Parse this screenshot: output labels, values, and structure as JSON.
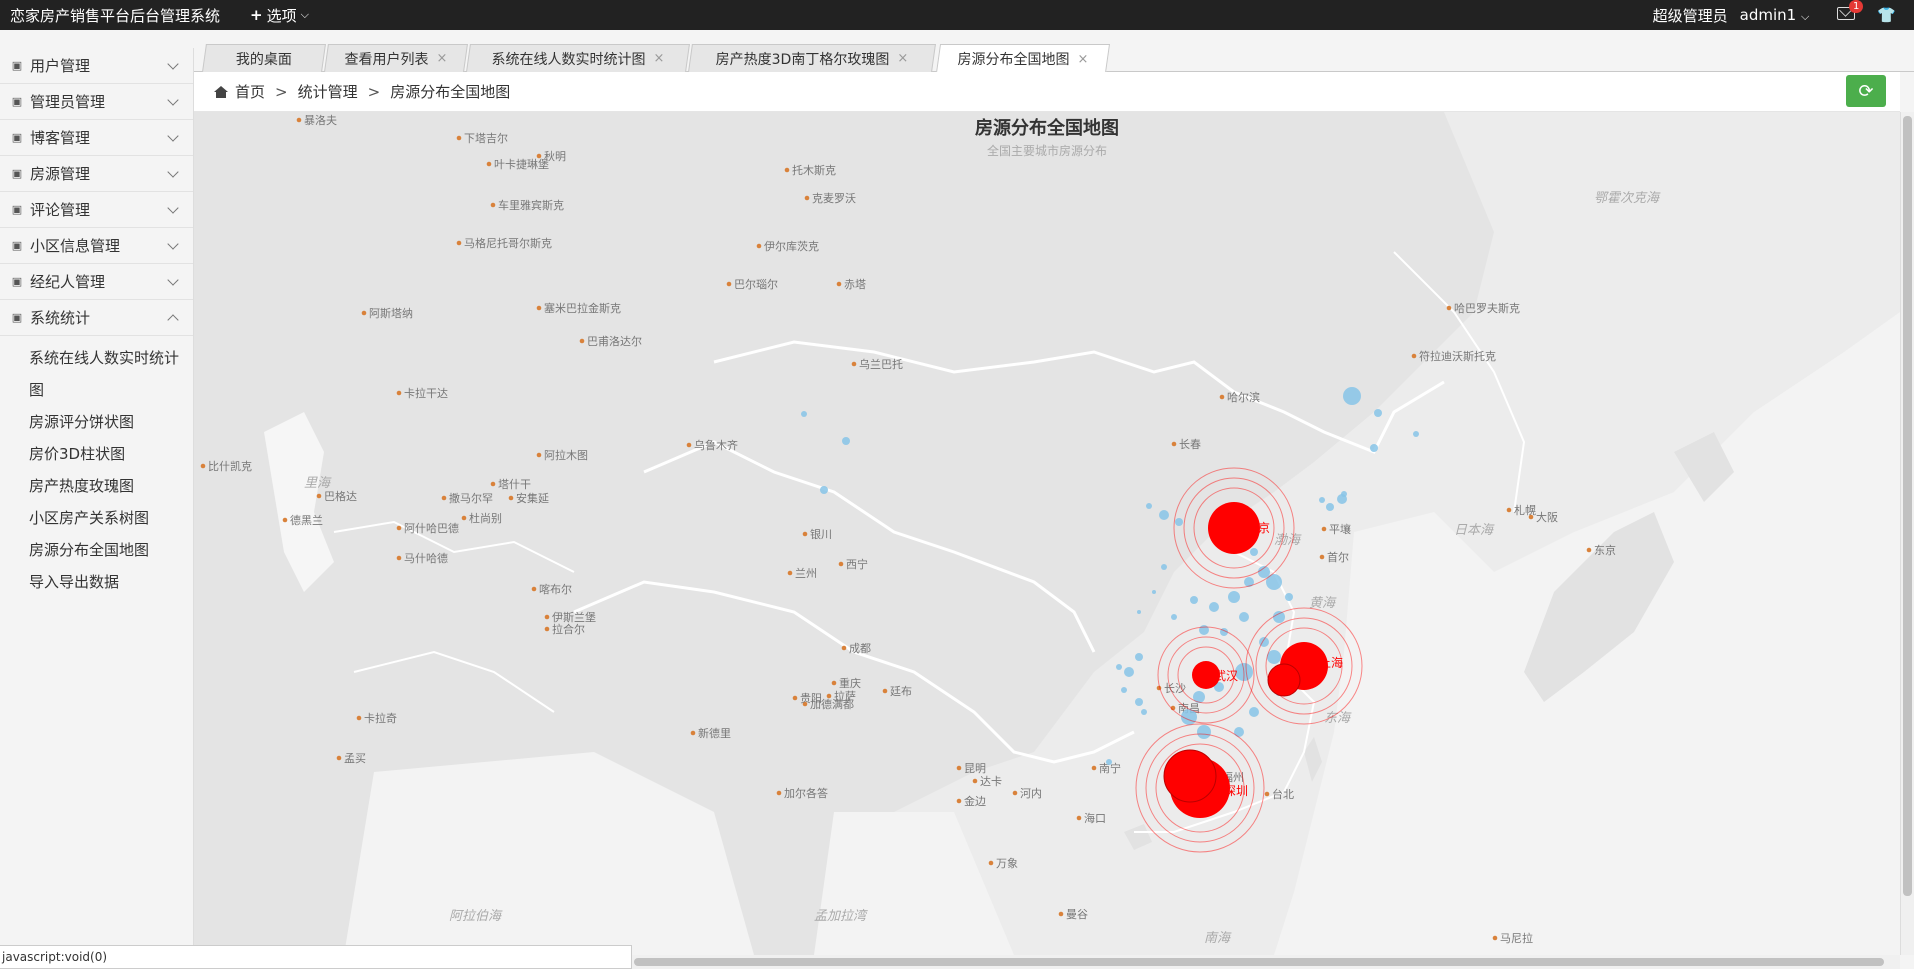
{
  "topbar": {
    "title": "恋家房产销售平台后台管理系统",
    "options_label": "选项",
    "role": "超级管理员",
    "user": "admin1",
    "badge_count": "1"
  },
  "sidebar": {
    "items": [
      {
        "label": "用户管理",
        "icon": "user-group-icon"
      },
      {
        "label": "管理员管理",
        "icon": "admin-icon"
      },
      {
        "label": "博客管理",
        "icon": "blog-icon"
      },
      {
        "label": "房源管理",
        "icon": "house-icon"
      },
      {
        "label": "评论管理",
        "icon": "comment-icon"
      },
      {
        "label": "小区信息管理",
        "icon": "community-icon"
      },
      {
        "label": "经纪人管理",
        "icon": "agent-icon"
      },
      {
        "label": "系统统计",
        "icon": "stats-icon"
      }
    ],
    "sub_items": [
      "系统在线人数实时统计图",
      "房源评分饼状图",
      "房价3D柱状图",
      "房产热度玫瑰图",
      "小区房产关系树图",
      "房源分布全国地图",
      "导入导出数据"
    ]
  },
  "tabs": [
    {
      "label": "我的桌面"
    },
    {
      "label": "查看用户列表"
    },
    {
      "label": "系统在线人数实时统计图"
    },
    {
      "label": "房产热度3D南丁格尔玫瑰图"
    },
    {
      "label": "房源分布全国地图"
    }
  ],
  "breadcrumb": {
    "home": "首页",
    "level1": "统计管理",
    "current": "房源分布全国地图"
  },
  "map": {
    "title": "房源分布全国地图",
    "subtitle": "全国主要城市房源分布",
    "highlight_color": "#ff0000",
    "point_color": "#87c4e8",
    "highlight_cities": [
      "北京",
      "上海",
      "武汉",
      "深圳"
    ],
    "labels": [
      "暴洛夫",
      "下塔吉尔",
      "秋明",
      "叶卡捷琳堡",
      "托木斯克",
      "克麦罗沃",
      "车里雅宾斯克",
      "马格尼托哥尔斯克",
      "巴尔瑙尔",
      "巴甫洛达尔",
      "塞米巴拉金斯克",
      "伊尔库茨克",
      "赤塔",
      "乌兰巴托",
      "阿斯塔纳",
      "卡拉干达",
      "乌鲁木齐",
      "阿拉木图",
      "比什凯克",
      "塔什干",
      "安集延",
      "撒马尔罕",
      "杜尚别",
      "阿什哈巴德",
      "马什哈德",
      "喀布尔",
      "伊斯兰堡",
      "拉合尔",
      "新德里",
      "加德满都",
      "廷布",
      "拉萨",
      "西宁",
      "兰州",
      "银川",
      "成都",
      "重庆",
      "贵阳",
      "昆明",
      "南宁",
      "海口",
      "福州",
      "台北",
      "南昌",
      "长沙",
      "沈阳",
      "长春",
      "哈尔滨",
      "平壤",
      "首尔",
      "大阪",
      "东京",
      "札幌",
      "符拉迪沃斯托克",
      "哈巴罗夫斯克",
      "马尼拉",
      "河内",
      "万象",
      "曼谷",
      "金边",
      "达卡",
      "加尔各答",
      "孟买",
      "卡拉奇",
      "德黑兰",
      "巴格达",
      "里海",
      "渤海",
      "黄海",
      "东海",
      "南海",
      "日本海",
      "鄂霍次克海",
      "阿拉伯海",
      "孟加拉湾"
    ],
    "sea_labels": [
      "里海",
      "渤海",
      "黄海",
      "东海",
      "南海",
      "日本海",
      "鄂霍次克海",
      "阿拉伯海",
      "孟加拉湾"
    ]
  },
  "statusbar": {
    "text": "javascript:void(0)"
  }
}
